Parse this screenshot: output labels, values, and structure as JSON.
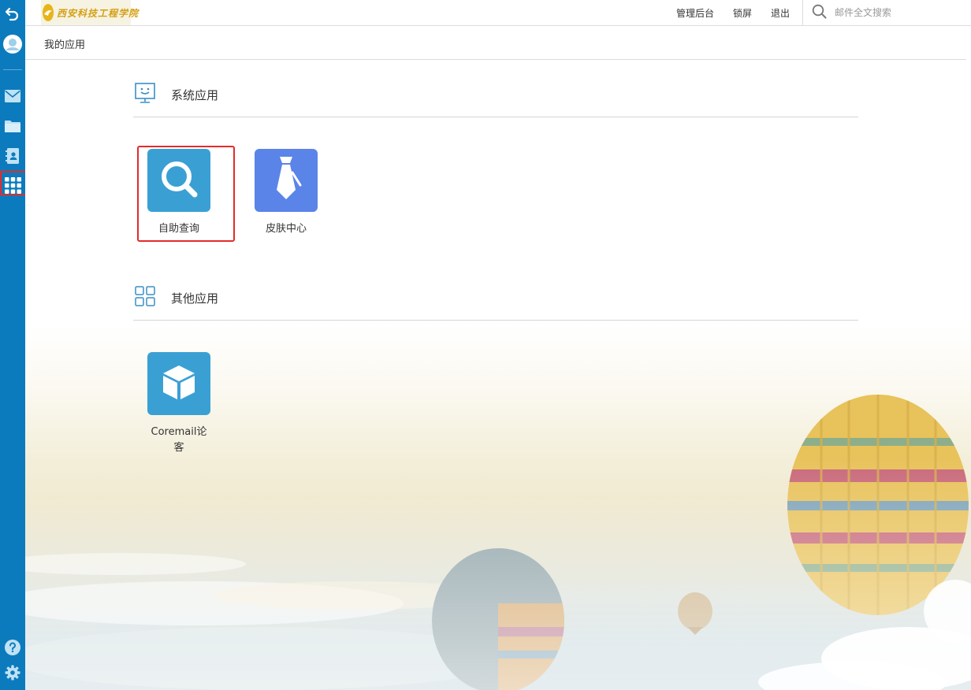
{
  "sidebar": {
    "items": [
      {
        "name": "back-icon"
      },
      {
        "name": "avatar-icon"
      },
      {
        "name": "mail-icon"
      },
      {
        "name": "folder-icon"
      },
      {
        "name": "contacts-icon"
      },
      {
        "name": "apps-grid-icon",
        "active": true
      }
    ],
    "bottom": [
      {
        "name": "help-icon"
      },
      {
        "name": "settings-icon"
      }
    ],
    "color": "#0c7bbd"
  },
  "header": {
    "logo_text": "西安科技工程学院",
    "links": [
      "管理后台",
      "锁屏",
      "退出"
    ],
    "search_placeholder": "邮件全文搜索"
  },
  "breadcrumb": {
    "title": "我的应用"
  },
  "sections": {
    "system": {
      "title": "系统应用",
      "apps": [
        {
          "label": "自助查询",
          "icon": "search-icon",
          "color": "#3aa0d4",
          "highlighted": true
        },
        {
          "label": "皮肤中心",
          "icon": "tie-icon",
          "color": "#5b84e8"
        }
      ]
    },
    "other": {
      "title": "其他应用",
      "apps": [
        {
          "label": "Coremail论客",
          "icon": "cube-icon",
          "color": "#3aa0d4"
        }
      ]
    }
  },
  "colors": {
    "highlight": "#e32b2b",
    "accent": "#0c7bbd"
  }
}
